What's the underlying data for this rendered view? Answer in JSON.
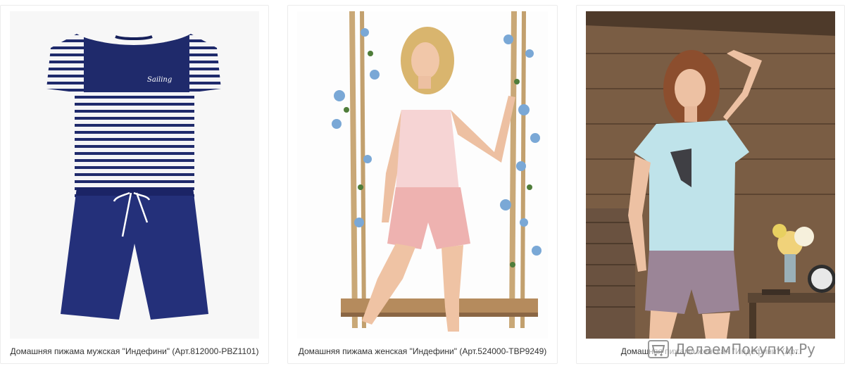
{
  "products": [
    {
      "caption": "Домашняя пижама мужская \"Индефини\" (Арт.812000-PBZ1101)",
      "image_label": "men-pajama-striped-tshirt-navy-shorts"
    },
    {
      "caption": "Домашняя пижама женская \"Индефини\" (Арт.524000-TBP9249)",
      "image_label": "woman-pink-pajama-on-swing"
    },
    {
      "caption": "Домашняя пижама женская \"Индефини\" (Арт.",
      "image_label": "woman-blue-tshirt-purple-shorts"
    }
  ],
  "watermark": {
    "text": "ДелаемПокупки.Ру"
  },
  "colors": {
    "navy": "#1f2a6b",
    "stripe_white": "#f4f4f6",
    "pink_top": "#f6d4d4",
    "pink_shorts": "#eeb2b0",
    "light_blue": "#bfe3ea",
    "purple_shorts": "#9b8597",
    "wood": "#7a5d44"
  }
}
